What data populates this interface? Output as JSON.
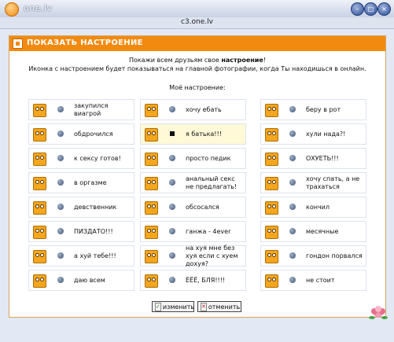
{
  "window": {
    "title": "one.lv"
  },
  "address": {
    "url": "c3.one.lv"
  },
  "panel": {
    "header": "ПОКАЗАТЬ НАСТРОЕНИЕ",
    "intro_line1_prefix": "Покажи всем друзьям свое ",
    "intro_line1_bold": "настроение",
    "intro_line1_suffix": "!",
    "intro_line2": "Иконка с настроением будет показываться на главной фотографии, когда Ты находишься в онлайн.",
    "subtitle": "Моё настроение:"
  },
  "columns": [
    [
      {
        "label": "закупился виагрой"
      },
      {
        "label": "обдрочился"
      },
      {
        "label": "к сексу готов!"
      },
      {
        "label": "в оргазме"
      },
      {
        "label": "девственник"
      },
      {
        "label": "ПИЗДАТО!!!"
      },
      {
        "label": "а хуй тебе!!!"
      },
      {
        "label": "даю всем"
      }
    ],
    [
      {
        "label": "хочу ебать"
      },
      {
        "label": "я батька!!!",
        "selected": true
      },
      {
        "label": "просто педик"
      },
      {
        "label": "анальный секс не предлагать!"
      },
      {
        "label": "обсосался"
      },
      {
        "label": "ганжа - 4ever"
      },
      {
        "label": "на хуя мне без хуя если с хуем дохуя?"
      },
      {
        "label": "ЁЁЁ, БЛЯ!!!!"
      }
    ],
    [
      {
        "label": "беру в рот"
      },
      {
        "label": "хули нада?!"
      },
      {
        "label": "ОХУЕТЬ!!!"
      },
      {
        "label": "хочу спать, а не трахаться"
      },
      {
        "label": "кончил"
      },
      {
        "label": "месячные"
      },
      {
        "label": "гондон порвался"
      },
      {
        "label": "не стоит"
      }
    ]
  ],
  "buttons": {
    "change": "изменить",
    "cancel": "отменить"
  },
  "colors": {
    "accent": "#f28a10",
    "selected_row": "#fff9d8"
  }
}
